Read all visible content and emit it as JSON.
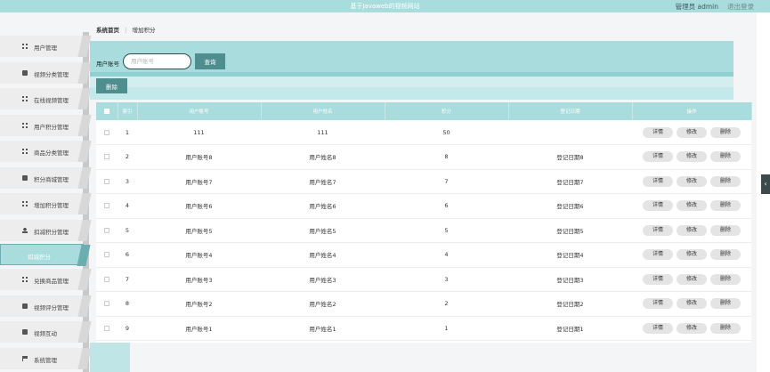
{
  "header": {
    "title": "基于Javaweb的视频网站",
    "user_label": "管理员 admin",
    "logout_label": "退出登录"
  },
  "sidebar": {
    "items": [
      {
        "label": "用户管理",
        "icon": "grid-icon"
      },
      {
        "label": "视频分类管理",
        "icon": "box-icon"
      },
      {
        "label": "在线视频管理",
        "icon": "grid-icon"
      },
      {
        "label": "用户积分管理",
        "icon": "grid-icon"
      },
      {
        "label": "商品分类管理",
        "icon": "grid-icon"
      },
      {
        "label": "积分商城管理",
        "icon": "box-icon"
      },
      {
        "label": "增加积分管理",
        "icon": "grid-icon"
      },
      {
        "label": "扣减积分管理",
        "icon": "user-icon"
      },
      {
        "label": "扣减积分",
        "icon": ""
      },
      {
        "label": "兑换商品管理",
        "icon": "grid-icon"
      },
      {
        "label": "视频评分管理",
        "icon": "box-icon"
      },
      {
        "label": "视频互动",
        "icon": "box-icon"
      },
      {
        "label": "系统管理",
        "icon": "flag-icon"
      }
    ]
  },
  "breadcrumb": {
    "home": "系统首页",
    "separator": "⋮",
    "current": "增加积分"
  },
  "search": {
    "label": "用户账号",
    "placeholder": "用户账号",
    "button_label": "查询"
  },
  "toolbar": {
    "delete_label": "删除"
  },
  "table": {
    "columns": [
      "",
      "索引",
      "用户账号",
      "用户姓名",
      "积分",
      "登记日期",
      "操作"
    ],
    "actions": [
      "详情",
      "修改",
      "删除"
    ],
    "rows": [
      {
        "index": "1",
        "account": "111",
        "name": "111",
        "points": "50",
        "date": ""
      },
      {
        "index": "2",
        "account": "用户账号8",
        "name": "用户姓名8",
        "points": "8",
        "date": "登记日期8"
      },
      {
        "index": "3",
        "account": "用户账号7",
        "name": "用户姓名7",
        "points": "7",
        "date": "登记日期7"
      },
      {
        "index": "4",
        "account": "用户账号6",
        "name": "用户姓名6",
        "points": "6",
        "date": "登记日期6"
      },
      {
        "index": "5",
        "account": "用户账号5",
        "name": "用户姓名5",
        "points": "5",
        "date": "登记日期5"
      },
      {
        "index": "6",
        "account": "用户账号4",
        "name": "用户姓名4",
        "points": "4",
        "date": "登记日期4"
      },
      {
        "index": "7",
        "account": "用户账号3",
        "name": "用户姓名3",
        "points": "3",
        "date": "登记日期3"
      },
      {
        "index": "8",
        "account": "用户账号2",
        "name": "用户姓名2",
        "points": "2",
        "date": "登记日期2"
      },
      {
        "index": "9",
        "account": "用户账号1",
        "name": "用户姓名1",
        "points": "1",
        "date": "登记日期1"
      }
    ]
  },
  "colors": {
    "accent": "#a9dcdd",
    "button": "#4f8e8f",
    "sidebar_bg": "#ededed"
  }
}
